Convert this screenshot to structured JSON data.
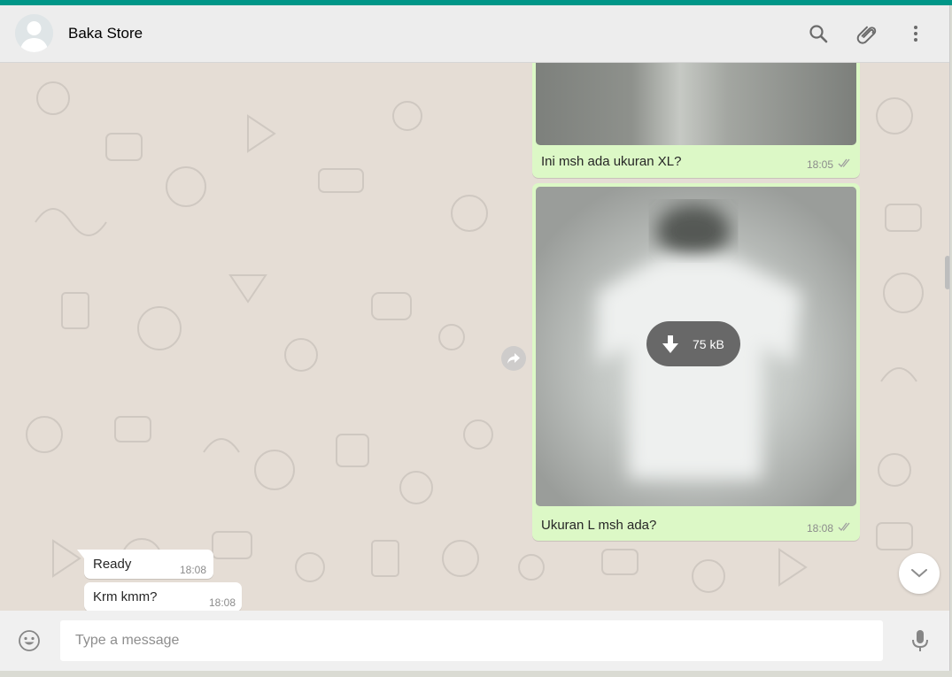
{
  "header": {
    "contact_name": "Baka Store",
    "icons": [
      "search-icon",
      "attach-icon",
      "menu-icon"
    ]
  },
  "messages": [
    {
      "direction": "outgoing",
      "type": "image",
      "caption": "Ini msh ada ukuran XL?",
      "time": "18:05",
      "status": "read"
    },
    {
      "direction": "outgoing",
      "type": "image",
      "download_size": "75 kB",
      "caption": "Ukuran L msh ada?",
      "time": "18:08",
      "status": "read"
    },
    {
      "direction": "incoming",
      "type": "text",
      "text": "Ready",
      "time": "18:08"
    },
    {
      "direction": "incoming",
      "type": "text",
      "text": "Krm kmm?",
      "time": "18:08"
    }
  ],
  "composer": {
    "placeholder": "Type a message"
  },
  "colors": {
    "accent": "#009688",
    "outgoing_bubble": "#dcf8c6",
    "incoming_bubble": "#ffffff",
    "chat_background": "#e5ddd5",
    "header_background": "#ededed",
    "read_tick": "#9e9e9e"
  }
}
